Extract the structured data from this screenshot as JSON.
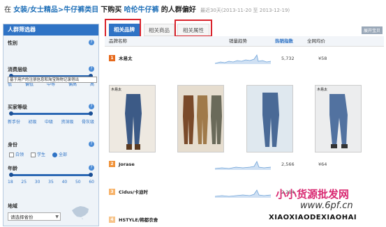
{
  "breadcrumb": {
    "prefix": "在",
    "category_path": "女装/女士精品>牛仔裤类目",
    "mid": "下购买",
    "brand": "哈伦牛仔裤",
    "suffix": "的人群偏好",
    "range": "最近30天(2013-11-20 至 2013-12-19)"
  },
  "sidebar": {
    "title": "人群筛选器",
    "gender": {
      "label": "性别",
      "tooltip": "基于用户的注册信息和淘宝购物记录得出"
    },
    "consumption": {
      "label": "消费层级",
      "ticks": [
        "低",
        "偏低",
        "中等",
        "偏高",
        "高"
      ]
    },
    "buyer_level": {
      "label": "买家等级",
      "ticks": [
        "新手份",
        "初级",
        "中级",
        "资深级",
        "骨灰级"
      ]
    },
    "identity": {
      "label": "身份",
      "options": [
        "白领",
        "学生",
        "全部"
      ],
      "selected": "全部"
    },
    "age": {
      "label": "年龄",
      "ticks": [
        "18",
        "25",
        "30",
        "35",
        "40",
        "50",
        "60"
      ]
    },
    "region": {
      "label": "地域",
      "placeholder": "请选择省份"
    }
  },
  "tabs": [
    {
      "label": "相关品牌",
      "active": true
    },
    {
      "label": "相关商品",
      "active": false
    },
    {
      "label": "相关属性",
      "active": false
    }
  ],
  "expand_label": "展开宝贝",
  "table": {
    "columns": [
      "品牌名称",
      "销量趋势",
      "热销指数",
      "全网均价"
    ],
    "rows": [
      {
        "rank": "1",
        "brand": "木易太",
        "index": "5,732",
        "price": "¥58"
      },
      {
        "rank": "2",
        "brand": "Jorase",
        "index": "2,566",
        "price": "¥64"
      },
      {
        "rank": "3",
        "brand": "Cidus/卡迪时",
        "index": "2,214",
        "price": ""
      },
      {
        "rank": "4",
        "brand": "HSTYLE/韩都衣舍",
        "index": "",
        "price": ""
      }
    ]
  },
  "gallery_tag": "木易太",
  "watermark": {
    "line1": "小小货源批发网",
    "line2": "www.6pf.cn",
    "line3": "XIAOXIAODEXIAOHAI"
  }
}
